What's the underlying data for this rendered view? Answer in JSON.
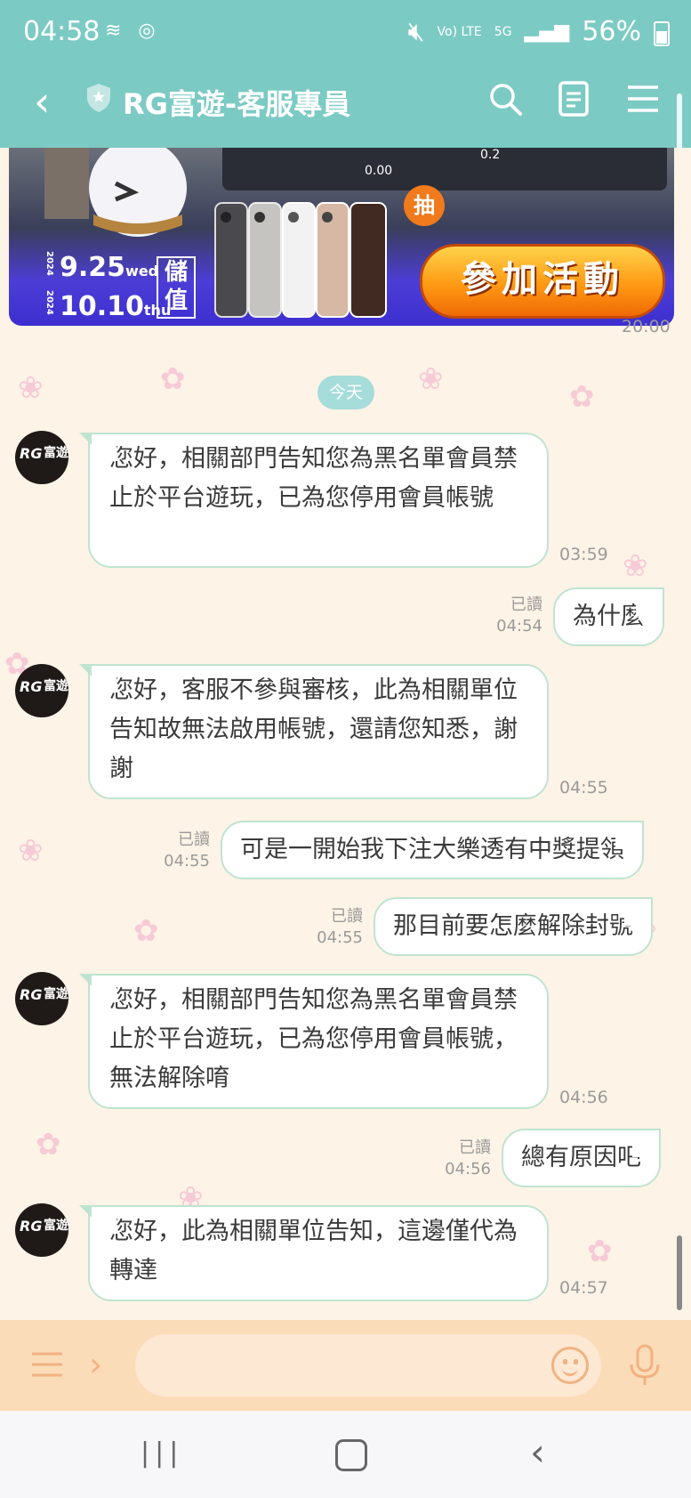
{
  "status_bar": {
    "time": "04:58",
    "network_volte": "Vo) LTE",
    "network_5g": "5G",
    "battery": "56%"
  },
  "header": {
    "title": "RG富遊-客服專員"
  },
  "banner": {
    "date_start": "9.25",
    "weekday_start": "wed",
    "date_end": "10.10",
    "weekday_end": "thu",
    "year": "2024",
    "deposit": "儲值",
    "draw": "抽",
    "cta": "參加活動",
    "slot_value_1": "0.00",
    "slot_value_2": "0.2"
  },
  "chat": {
    "banner_time": "20:00",
    "day_label": "今天",
    "avatar_text": "富遊",
    "avatar_logo": "RG",
    "messages": [
      {
        "dir": "in",
        "text": "您好，相關部門告知您為黑名單會員禁止於平台遊玩，已為您停用會員帳號",
        "time": "03:59"
      },
      {
        "dir": "out",
        "text": "為什麼",
        "time": "04:54",
        "read": "已讀"
      },
      {
        "dir": "in",
        "text": "您好，客服不參與審核，此為相關單位告知故無法啟用帳號，還請您知悉，謝謝",
        "time": "04:55"
      },
      {
        "dir": "out",
        "text": "可是一開始我下注大樂透有中獎提領",
        "time": "04:55",
        "read": "已讀"
      },
      {
        "dir": "out",
        "text": "那目前要怎麼解除封號",
        "time": "04:55",
        "read": "已讀"
      },
      {
        "dir": "in",
        "text": "您好，相關部門告知您為黑名單會員禁止於平台遊玩，已為您停用會員帳號，無法解除唷",
        "time": "04:56"
      },
      {
        "dir": "out",
        "text": "總有原因吧",
        "time": "04:56",
        "read": "已讀"
      },
      {
        "dir": "in",
        "text": "您好，此為相關單位告知，這邊僅代為轉達",
        "time": "04:57"
      }
    ]
  },
  "input": {
    "placeholder": ""
  },
  "icons": {
    "back": "chevron-left-icon",
    "shield": "shield-star-icon",
    "search": "search-icon",
    "note": "note-icon",
    "menu": "hamburger-icon",
    "emoji": "emoji-icon",
    "mic": "microphone-icon"
  },
  "colors": {
    "header": "#7ccac4",
    "bubble_border": "#bfe4cf",
    "chat_bg": "#fdf3e6",
    "input_bg": "#fbdcb8"
  }
}
